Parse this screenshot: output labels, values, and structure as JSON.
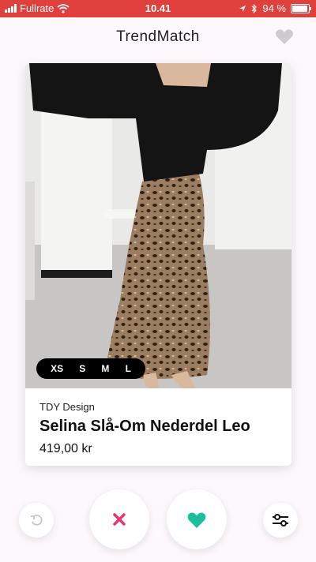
{
  "status_bar": {
    "carrier": "Fullrate",
    "time": "10.41",
    "battery": "94 %"
  },
  "header": {
    "title": "TrendMatch"
  },
  "product": {
    "sizes": [
      "XS",
      "S",
      "M",
      "L"
    ],
    "brand": "TDY Design",
    "name": "Selina Slå-Om Nederdel Leo",
    "price": "419,00 kr"
  },
  "colors": {
    "status_bar": "#e0403c",
    "dislike": "#e8356b",
    "like": "#1bbf9c"
  },
  "icons": [
    "signal-icon",
    "wifi-icon",
    "location-icon",
    "bluetooth-icon",
    "battery-icon",
    "heart-icon",
    "undo-icon",
    "close-icon",
    "heart-filled-icon",
    "filter-icon"
  ]
}
